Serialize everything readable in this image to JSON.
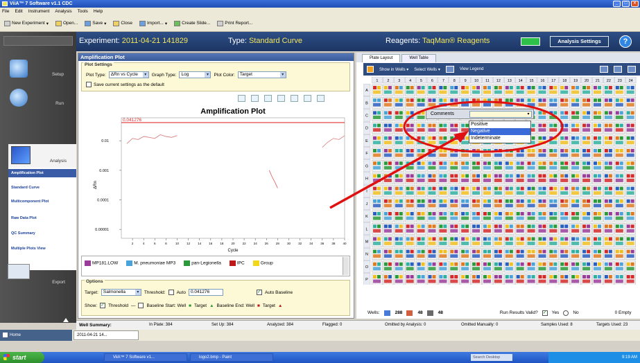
{
  "window": {
    "title": "ViiA™ 7 Software v1.1 CDC"
  },
  "menu": [
    "File",
    "Edit",
    "Instrument",
    "Analysis",
    "Tools",
    "Help"
  ],
  "toolbar": {
    "new_experiment": "New Experiment",
    "open": "Open...",
    "save": "Save",
    "close": "Close",
    "import": "Import...",
    "create_slide": "Create Slide...",
    "print_report": "Print Report..."
  },
  "header": {
    "experiment_label": "Experiment:",
    "experiment_value": "2011-04-21 141829",
    "type_label": "Type:",
    "type_value": "Standard Curve",
    "reagents_label": "Reagents:",
    "reagents_value": "TaqMan® Reagents",
    "analysis_settings": "Analysis Settings"
  },
  "nav": {
    "setup": "Setup",
    "run": "Run",
    "analysis": "Analysis",
    "export": "Export",
    "subitems": [
      "Amplification Plot",
      "Standard Curve",
      "Multicomponent Plot",
      "Raw Data Plot",
      "QC Summary",
      "Multiple Plots View"
    ]
  },
  "amp_panel": {
    "title": "Amplification Plot",
    "plot_settings_label": "Plot Settings",
    "plot_type_label": "Plot Type:",
    "plot_type_value": "ΔRn vs Cycle",
    "graph_type_label": "Graph Type:",
    "graph_type_value": "Log",
    "plot_color_label": "Plot Color:",
    "plot_color_value": "Target",
    "save_default": "Save current settings as the default"
  },
  "chart_data": {
    "type": "line",
    "title": "Amplification Plot",
    "xlabel": "Cycle",
    "ylabel": "ΔRn",
    "yscale": "log",
    "ylim": [
      5e-06,
      0.06
    ],
    "xlim": [
      0,
      40
    ],
    "xticks": [
      2,
      4,
      6,
      8,
      10,
      12,
      14,
      16,
      18,
      20,
      22,
      24,
      26,
      28,
      30,
      32,
      34,
      36,
      38,
      40
    ],
    "yticks": [
      {
        "value": 0.01,
        "label": "0.01"
      },
      {
        "value": 0.001,
        "label": "0.001"
      },
      {
        "value": 0.0001,
        "label": "0.0001"
      },
      {
        "value": 1e-05,
        "label": "0.00001"
      }
    ],
    "threshold": {
      "value": 0.041276,
      "label": "0.041276",
      "color": "#e03030"
    },
    "series": [
      {
        "color": "#d98080",
        "x": [
          1,
          2,
          3,
          4,
          5,
          6,
          7,
          8,
          9,
          10
        ],
        "y": [
          0.008,
          0.012,
          0.011,
          0.014,
          0.013,
          0.012,
          0.016,
          0.014,
          0.013,
          0.015
        ]
      },
      {
        "color": "#e08a8a",
        "x": [
          36,
          37,
          38,
          39,
          40
        ],
        "y": [
          0.006,
          0.009,
          0.012,
          0.011,
          0.015
        ]
      },
      {
        "color": "#e06a6a",
        "x": [
          26.5,
          27,
          27.5,
          28
        ],
        "y": [
          0.001,
          0.0006,
          0.0004,
          0.00025
        ]
      }
    ],
    "grid": false
  },
  "legend": {
    "items": [
      {
        "label": "MP181.LOW",
        "color": "#9a3d9a"
      },
      {
        "label": "M. pneumoniae MP3",
        "color": "#4aa3d8"
      },
      {
        "label": "pan-Legionella",
        "color": "#2a9a3a"
      },
      {
        "label": "IPC",
        "color": "#c01818"
      },
      {
        "label": "Group",
        "color": "#f2d81a"
      }
    ]
  },
  "options": {
    "title": "Options",
    "target_label": "Target:",
    "target_value": "Salmonella",
    "threshold_label": "Threshold:",
    "auto_label": "Auto",
    "threshold_value": "0.041276",
    "auto_baseline": "Auto Baseline",
    "show_label": "Show:",
    "threshold_cb": "Threshold",
    "baseline_start": "Baseline Start: Well",
    "target1": "Target",
    "baseline_end": "Baseline End: Well",
    "target2": "Target"
  },
  "plate": {
    "tab_layout": "Plate Layout",
    "tab_table": "Well Table",
    "show_in_wells": "Show in Wells",
    "select_wells": "Select Wells",
    "view_legend": "View Legend",
    "columns": [
      "1",
      "2",
      "3",
      "4",
      "5",
      "6",
      "7",
      "8",
      "9",
      "10",
      "11",
      "12",
      "13",
      "14",
      "15",
      "16",
      "17",
      "18",
      "19",
      "20",
      "21",
      "22",
      "23",
      "24"
    ],
    "rows": [
      "A",
      "B",
      "C",
      "D",
      "E",
      "F",
      "G",
      "H",
      "I",
      "J",
      "K",
      "L",
      "M",
      "N",
      "O",
      "P"
    ],
    "wells_label": "Wells:",
    "wells_count1": "288",
    "wells_count2": "48",
    "wells_count3": "48",
    "run_valid": "Run Results Valid?",
    "yes": "Yes",
    "no": "No",
    "empty": "0 Empty"
  },
  "comments_dropdown": {
    "label": "Comments",
    "options": [
      "Positive",
      "Negative",
      "Indeterminate"
    ],
    "highlighted": "Negative"
  },
  "summary": {
    "label": "Well Summary:",
    "in_plate": "In Plate: 384",
    "set_up": "Set Up: 384",
    "analyzed": "Analyzed: 384",
    "flagged": "Flagged: 0",
    "omitted_analysis": "Omitted by Analysis: 0",
    "omitted_manually": "Omitted Manually: 0",
    "samples_used": "Samples Used: 8",
    "targets_used": "Targets Used: 23"
  },
  "bottom": {
    "home": "Home",
    "file_tab": "2011-04-21 14..."
  },
  "taskbar": {
    "start": "start",
    "task1": "ViiA™ 7 Software v1...",
    "task2": "logo2.bmp - Paint",
    "search": "Search Desktop",
    "clock": "9:19 AM"
  },
  "colors": {
    "header_bg": "#22406f",
    "accent_yellow": "#f4e65b",
    "threshold_red": "#e03030",
    "annotation_red": "#e01010",
    "well_colors": [
      "#d42a2a",
      "#2a9a3a",
      "#2a5fc0",
      "#f0c020",
      "#9a3d9a",
      "#4aa3d8",
      "#e07a20",
      "#30b0a0"
    ]
  }
}
